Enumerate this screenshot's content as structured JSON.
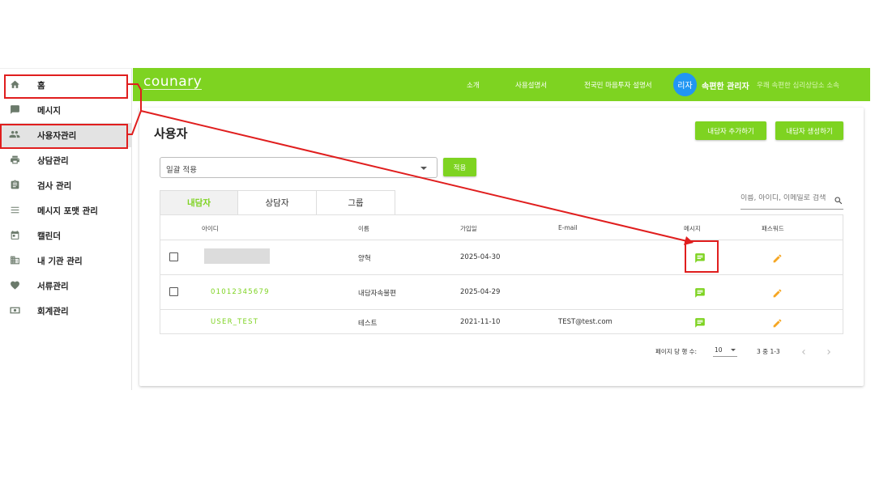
{
  "sidebar": {
    "items": [
      {
        "label": "홈",
        "icon": "home-icon"
      },
      {
        "label": "메시지",
        "icon": "message-icon"
      },
      {
        "label": "사용자관리",
        "icon": "people-icon"
      },
      {
        "label": "상담관리",
        "icon": "print-icon"
      },
      {
        "label": "검사 관리",
        "icon": "clipboard-icon"
      },
      {
        "label": "메시지 포맷 관리",
        "icon": "list-icon"
      },
      {
        "label": "캘린더",
        "icon": "calendar-icon"
      },
      {
        "label": "내 기관 관리",
        "icon": "building-icon"
      },
      {
        "label": "서류관리",
        "icon": "heart-icon"
      },
      {
        "label": "회계관리",
        "icon": "money-icon"
      }
    ]
  },
  "topbar": {
    "logo": "counary",
    "nav": [
      "소개",
      "사용설명서",
      "전국민 마음투자 설명서"
    ],
    "avatar": "리자",
    "user_name": "속편한 관리자",
    "user_org": "우쾌 속편한 심리상담소 소속"
  },
  "main": {
    "title": "사용자",
    "add_counselee_button": "내담자 추가하기",
    "create_counselee_button": "내담자 생성하기",
    "bulk_select_value": "일괄 적용",
    "apply_button": "적용",
    "tabs": [
      {
        "label": "내담자",
        "active": true
      },
      {
        "label": "상담자",
        "active": false
      },
      {
        "label": "그룹",
        "active": false
      }
    ],
    "search_placeholder": "이름, 아이디, 이메일로 검색",
    "table": {
      "headers": {
        "id": "아이디",
        "name": "이름",
        "joined": "가입일",
        "email": "E-mail",
        "message": "메시지",
        "password": "패스워드"
      },
      "rows": [
        {
          "id": "",
          "name": "양혁",
          "joined": "2025-04-30",
          "email": ""
        },
        {
          "id": "01012345679",
          "name": "내담자속불편",
          "joined": "2025-04-29",
          "email": ""
        },
        {
          "id": "USER_TEST",
          "name": "테스트",
          "joined": "2021-11-10",
          "email": "TEST@test.com"
        }
      ]
    },
    "pagination": {
      "rows_per_page_label": "페이지 당 행 수:",
      "rows_per_page_value": "10",
      "range_text": "3 중 1-3"
    }
  },
  "colors": {
    "accent_green": "#7ed321",
    "avatar_blue": "#2196f3",
    "edit_orange": "#f5a623",
    "highlight_red": "#e01e1e"
  }
}
